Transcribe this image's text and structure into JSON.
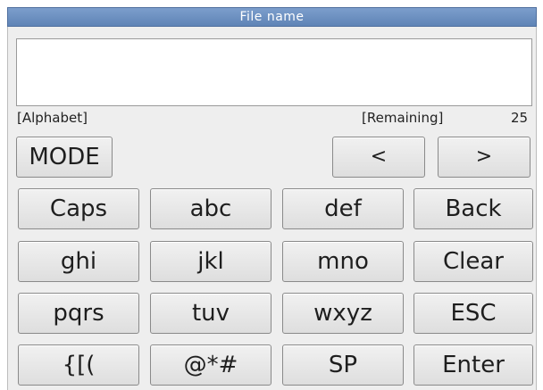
{
  "window": {
    "title": "File name"
  },
  "input": {
    "value": ""
  },
  "status": {
    "mode_label": "[Alphabet]",
    "remaining_label": "[Remaining]",
    "remaining_count": "25"
  },
  "keys": {
    "mode": "MODE",
    "left": "<",
    "right": ">",
    "caps": "Caps",
    "abc": "abc",
    "def": "def",
    "back": "Back",
    "ghi": "ghi",
    "jkl": "jkl",
    "mno": "mno",
    "clear": "Clear",
    "pqrs": "pqrs",
    "tuv": "tuv",
    "wxyz": "wxyz",
    "esc": "ESC",
    "brackets": "{[(",
    "symbols": "@*#",
    "sp": "SP",
    "enter": "Enter"
  }
}
